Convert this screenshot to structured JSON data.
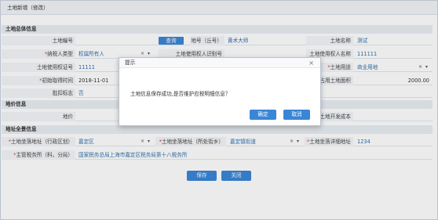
{
  "window": {
    "title": "土地新增（修改）"
  },
  "sections": {
    "overall": "土地总体信息",
    "price": "地价信息",
    "location": "地址全景信息"
  },
  "overall": {
    "land_no_label": "土地编号",
    "query_button": "查询",
    "plot_no_label": "地号（丘号）",
    "plot_no_value": "黄术大师",
    "land_name_label": "土地名称",
    "land_name_value": "测试",
    "taxpayer_type_label": "纳税人类型",
    "taxpayer_type_value": "权属所有人",
    "user_id_label": "土地使用权人识别号",
    "user_name_label": "土地使用权人名称",
    "user_name_value": "111111",
    "cert_no_label": "土地使用权证号",
    "cert_no_value": "11111",
    "land_use_label": "土地用途",
    "land_use_value": "商业用地",
    "acquire_time_label": "初始取得时间",
    "acquire_time_value": "2018-11-01",
    "area_label": "占用土地面积",
    "area_value": "2000.00",
    "batch_flag_label": "批扣标志",
    "batch_flag_value": "否"
  },
  "price": {
    "price_label": "地价",
    "dev_cost_label": "土地开发成本"
  },
  "location": {
    "district_label": "土地坐落地址（行政区划）",
    "district_value": "嘉定区",
    "street_label": "土地坐落地址（所处街乡）",
    "street_value": "嘉定镇街道",
    "detail_label": "土地坐落详细地址",
    "detail_value": "1234",
    "tax_office_label": "主管税务所（科，分局）",
    "tax_office_value": "国家税务总局上海市嘉定区税务局第十八税务所"
  },
  "footer": {
    "save": "保存",
    "close": "关闭"
  },
  "dialog": {
    "title": "提示",
    "message": "土地信息保存成功,是否维护应税明细信息？",
    "confirm": "确定",
    "cancel": "取消",
    "close_glyph": "×"
  },
  "glyphs": {
    "clear": "×",
    "dropdown": "▾",
    "required": "*"
  },
  "colors": {
    "accent": "#3a86d6",
    "value_text": "#2f6fb0",
    "required": "#e03a3a"
  }
}
